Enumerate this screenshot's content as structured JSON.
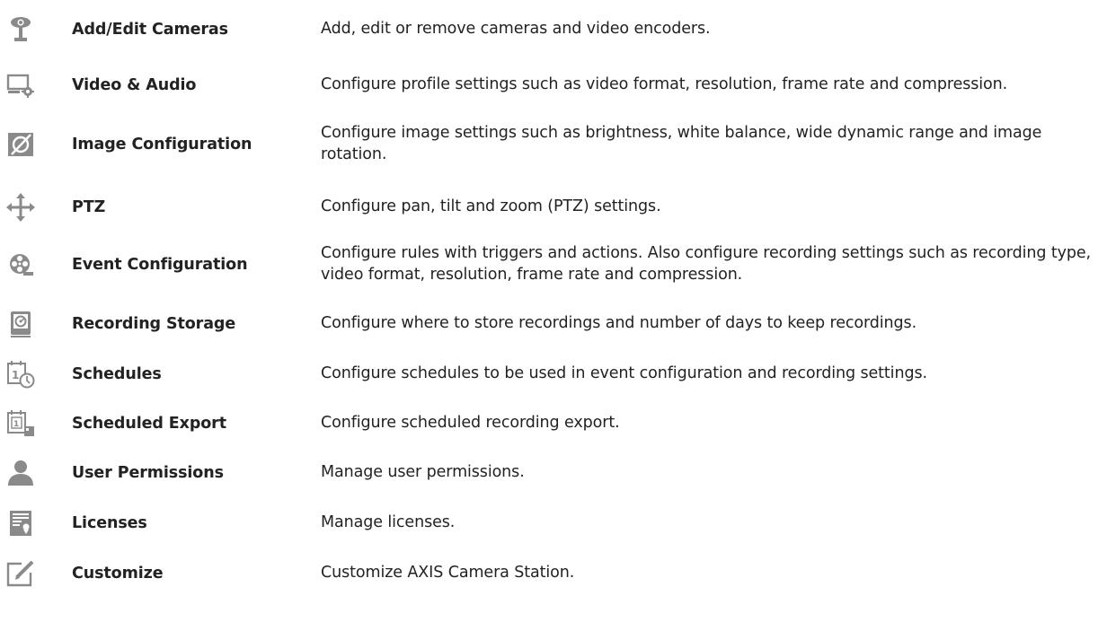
{
  "items": [
    {
      "icon": "camera-icon",
      "name": "Add/Edit Cameras",
      "description": "Add, edit or remove cameras and video encoders."
    },
    {
      "icon": "monitor-gear-icon",
      "name": "Video & Audio",
      "description": "Configure profile settings such as video format, resolution, frame rate and compression."
    },
    {
      "icon": "image-icon",
      "name": "Image Configuration",
      "description": "Configure image settings such as brightness, white balance, wide dynamic range and image rotation."
    },
    {
      "icon": "ptz-arrows-icon",
      "name": "PTZ",
      "description": "Configure pan, tilt and zoom (PTZ) settings."
    },
    {
      "icon": "film-reel-icon",
      "name": "Event Configuration",
      "description": "Configure rules with triggers and actions. Also configure recording settings such as recording type, video format, resolution, frame rate and compression."
    },
    {
      "icon": "storage-disk-icon",
      "name": "Recording Storage",
      "description": "Configure where to store recordings and number of days to keep recordings."
    },
    {
      "icon": "calendar-clock-icon",
      "name": "Schedules",
      "description": "Configure schedules to be used in event configuration and recording settings."
    },
    {
      "icon": "calendar-export-icon",
      "name": "Scheduled Export",
      "description": "Configure scheduled recording export."
    },
    {
      "icon": "user-icon",
      "name": "User Permissions",
      "description": "Manage user permissions."
    },
    {
      "icon": "license-certificate-icon",
      "name": "Licenses",
      "description": "Manage licenses."
    },
    {
      "icon": "customize-pencil-icon",
      "name": "Customize",
      "description": "Customize AXIS Camera Station."
    }
  ],
  "colors": {
    "icon_gray": "#8a8a8a",
    "icon_dark": "#6f6f6f",
    "text": "#222222"
  }
}
